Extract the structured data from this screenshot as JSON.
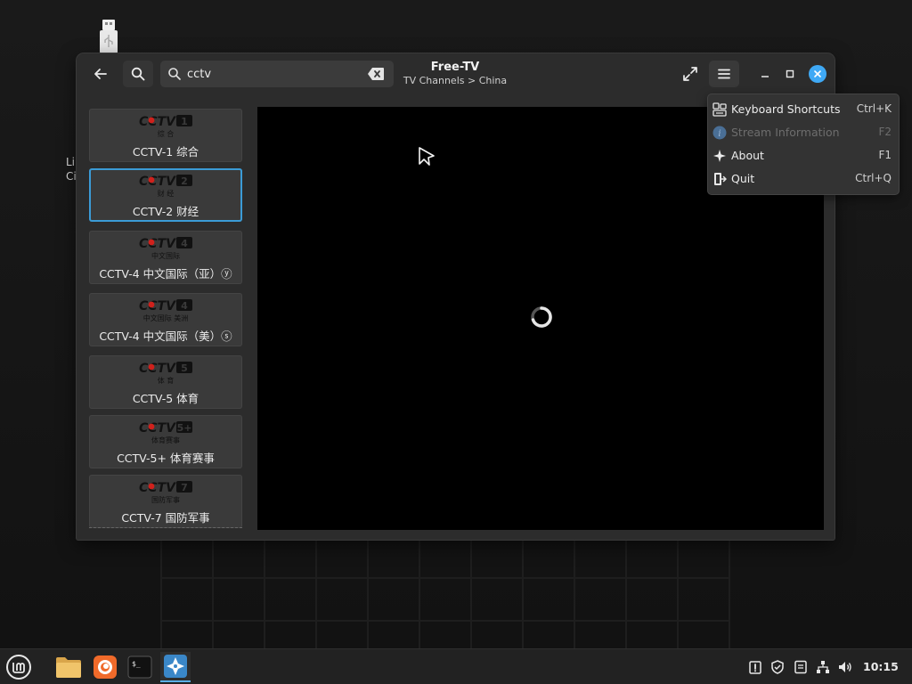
{
  "desktop": {
    "label_line1": "Li",
    "label_line2": "Ci"
  },
  "window": {
    "title": "Free-TV",
    "subtitle": "TV Channels > China",
    "search": {
      "value": "cctv",
      "placeholder": ""
    }
  },
  "channels": [
    {
      "name": "CCTV-1 综合",
      "logo_num": "1",
      "logo_sub": "综 合"
    },
    {
      "name": "CCTV-2 财经",
      "logo_num": "2",
      "logo_sub": "财 经",
      "selected": true
    },
    {
      "name": "CCTV-4 中文国际（亚）ⓨ",
      "logo_num": "4",
      "logo_sub": "中文国际"
    },
    {
      "name": "CCTV-4 中文国际（美）ⓢ",
      "logo_num": "4",
      "logo_sub": "中文国际 美洲"
    },
    {
      "name": "CCTV-5 体育",
      "logo_num": "5",
      "logo_sub": "体 育"
    },
    {
      "name": "CCTV-5+ 体育赛事",
      "logo_num": "5+",
      "logo_sub": "体育赛事"
    },
    {
      "name": "CCTV-7 国防军事",
      "logo_num": "7",
      "logo_sub": "国防军事"
    }
  ],
  "menu": {
    "items": [
      {
        "label": "Keyboard Shortcuts",
        "accel": "Ctrl+K",
        "icon": "keyboard-shortcuts-icon",
        "enabled": true
      },
      {
        "label": "Stream Information",
        "accel": "F2",
        "icon": "info-icon",
        "enabled": false
      },
      {
        "label": "About",
        "accel": "F1",
        "icon": "about-icon",
        "enabled": true
      },
      {
        "label": "Quit",
        "accel": "Ctrl+Q",
        "icon": "quit-icon",
        "enabled": true
      }
    ]
  },
  "taskbar": {
    "clock": "10:15",
    "apps": [
      "mint-menu-icon",
      "files-icon",
      "firefox-icon",
      "terminal-icon",
      "freetv-icon"
    ]
  },
  "colors": {
    "accent": "#3fa9f5",
    "selection": "#3b9bd6",
    "cctv_red": "#d0211c"
  }
}
